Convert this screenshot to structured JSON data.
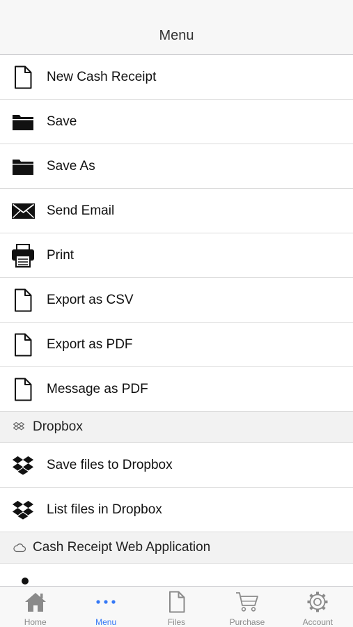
{
  "header": {
    "title": "Menu"
  },
  "menu": {
    "items": [
      {
        "label": "New Cash Receipt",
        "icon": "document-icon"
      },
      {
        "label": "Save",
        "icon": "folder-icon"
      },
      {
        "label": "Save As",
        "icon": "folder-icon"
      },
      {
        "label": "Send Email",
        "icon": "envelope-icon"
      },
      {
        "label": "Print",
        "icon": "printer-icon"
      },
      {
        "label": "Export as CSV",
        "icon": "document-icon"
      },
      {
        "label": "Export as PDF",
        "icon": "document-icon"
      },
      {
        "label": "Message as PDF",
        "icon": "document-icon"
      }
    ],
    "dropbox_section": {
      "title": "Dropbox",
      "icon": "dropbox-icon",
      "items": [
        {
          "label": "Save files to Dropbox",
          "icon": "dropbox-icon"
        },
        {
          "label": "List files in Dropbox",
          "icon": "dropbox-icon"
        }
      ]
    },
    "web_section": {
      "title": "Cash Receipt Web Application",
      "icon": "cloud-icon"
    }
  },
  "tabbar": {
    "active": "Menu",
    "accent_color": "#3478f6",
    "tabs": [
      {
        "label": "Home",
        "icon": "home-icon"
      },
      {
        "label": "Menu",
        "icon": "more-dots-icon"
      },
      {
        "label": "Files",
        "icon": "file-icon"
      },
      {
        "label": "Purchase",
        "icon": "cart-icon"
      },
      {
        "label": "Account",
        "icon": "gear-icon"
      }
    ]
  }
}
